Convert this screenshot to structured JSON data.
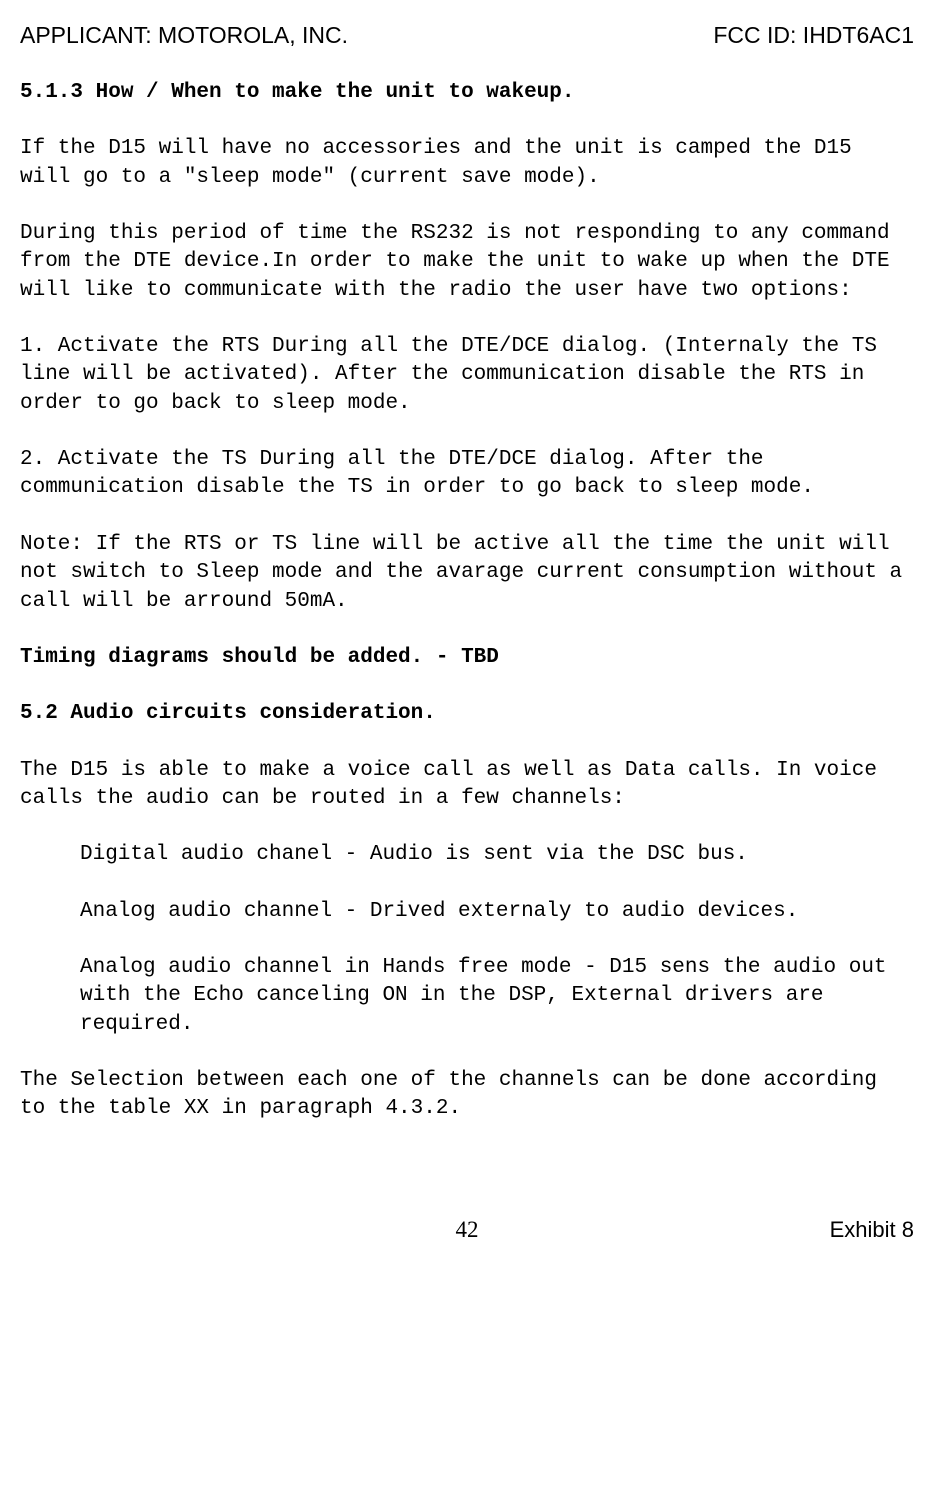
{
  "header": {
    "applicant_label": "APPLICANT:  MOTOROLA, INC.",
    "fcc_id": "FCC ID: IHDT6AC1"
  },
  "s513": {
    "heading": "5.1.3 How / When to make the unit to wakeup.",
    "p1": "If the D15 will have no accessories and the unit is camped the D15 will go to a \"sleep mode\" (current save mode).",
    "p2": "During this period of time the RS232 is not responding to any command from the DTE device.In order to make the unit to wake up when the DTE will like to communicate with the radio the user have two options:",
    "p3": "1. Activate the RTS During all the DTE/DCE dialog. (Internaly the TS line will be activated). After the communication disable the RTS in order to go back to sleep mode.",
    "p4": "2. Activate the TS During all the DTE/DCE dialog. After the communication disable the TS in order to go back to sleep mode.",
    "p5": "Note: If the RTS or TS line will be active all the time the unit will not switch to Sleep mode and the avarage current consumption without a call will be arround 50mA.",
    "tbd": "Timing diagrams should be added. - TBD"
  },
  "s52": {
    "heading": "5.2 Audio circuits consideration.",
    "p1": "The D15 is able to make a voice call as well as Data calls. In voice calls the audio can be routed in a few channels:",
    "bullets": [
      "Digital audio chanel - Audio is sent via the DSC bus.",
      "Analog audio channel - Drived externaly to audio devices.",
      "Analog audio channel in Hands free mode - D15 sens the audio out with the Echo canceling ON in the DSP, External drivers are required."
    ],
    "p2": "The Selection between each one of the channels can be done according to the table XX in paragraph 4.3.2."
  },
  "footer": {
    "page": "42",
    "exhibit": "Exhibit 8"
  }
}
